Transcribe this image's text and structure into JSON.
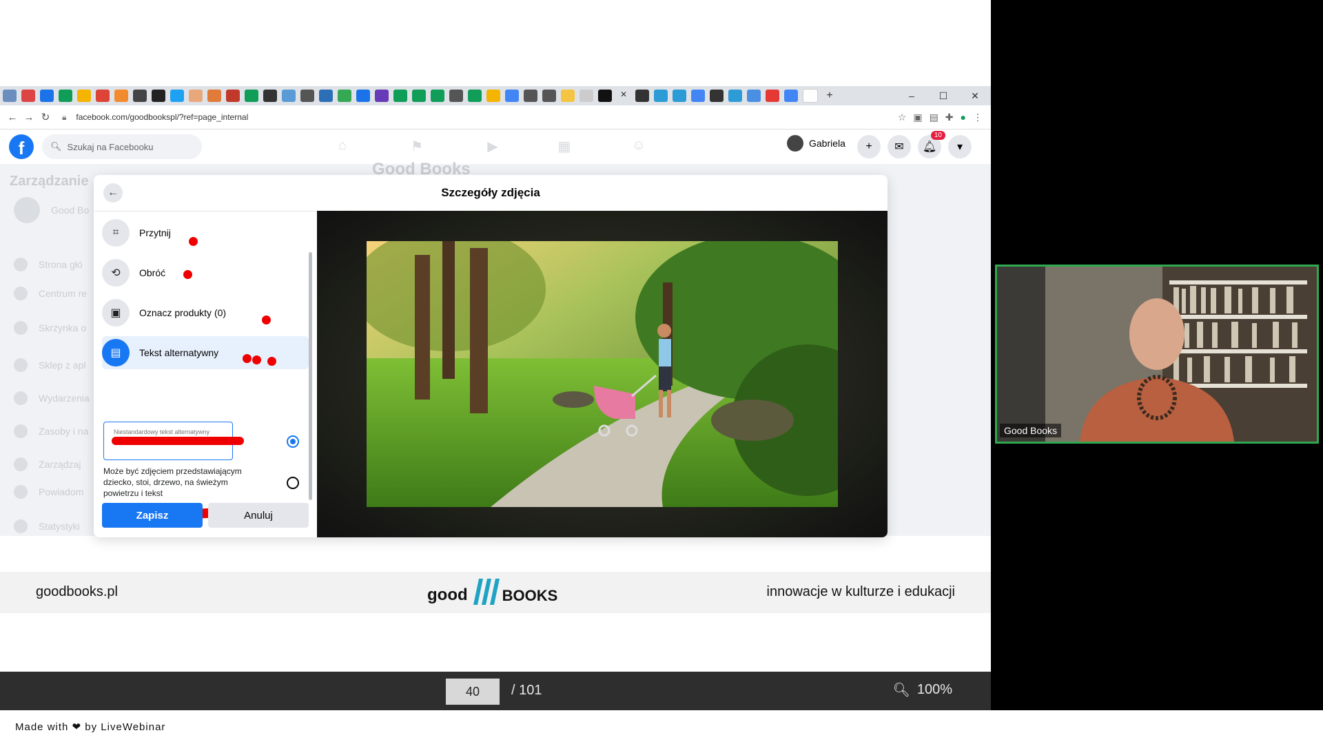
{
  "browser": {
    "url": "facebook.com/goodbookspl/?ref=page_internal",
    "window_controls": [
      "–",
      "☐",
      "✕"
    ]
  },
  "facebook": {
    "search_placeholder": "Szukaj na Facebooku",
    "user_name": "Gabriela",
    "notification_count": "10"
  },
  "background_page": {
    "sidebar_title": "Zarządzanie",
    "page_name": "Good Books",
    "sidebar_items": [
      "Good Bo",
      "Strona głó",
      "Centrum re",
      "Skrzynka o",
      "Sklep z apl",
      "Wydarzenia",
      "Zasoby i na",
      "Zarządzaj",
      "Powiadom",
      "Statystyki"
    ]
  },
  "dialog": {
    "title": "Szczegóły zdjęcia",
    "options": [
      {
        "label": "Przytnij",
        "icon": "crop-icon"
      },
      {
        "label": "Obróć",
        "icon": "rotate-icon"
      },
      {
        "label": "Oznacz produkty (0)",
        "icon": "tag-product-icon"
      },
      {
        "label": "Tekst alternatywny",
        "icon": "alt-text-icon"
      }
    ],
    "alt_text_placeholder": "Niestandardowy tekst alternatywny",
    "suggested_alt_text": "Może być zdjęciem przedstawiającym dziecko, stoi, drzewo, na świeżym powietrzu i tekst",
    "save_label": "Zapisz",
    "cancel_label": "Anuluj"
  },
  "slide_footer": {
    "site": "goodbooks.pl",
    "logo_left": "good",
    "logo_right": "BOOKS",
    "tagline": "innowacje w kulturze i edukacji"
  },
  "pager": {
    "current": "40",
    "total": "/ 101",
    "zoom": "100%"
  },
  "made_with": {
    "prefix": "Made with",
    "suffix": "by LiveWebinar"
  },
  "webcam": {
    "label": "Good Books"
  },
  "colors": {
    "facebook_blue": "#1877f2",
    "annotation_red": "#ee0000",
    "webcam_border": "#2fa84f"
  }
}
